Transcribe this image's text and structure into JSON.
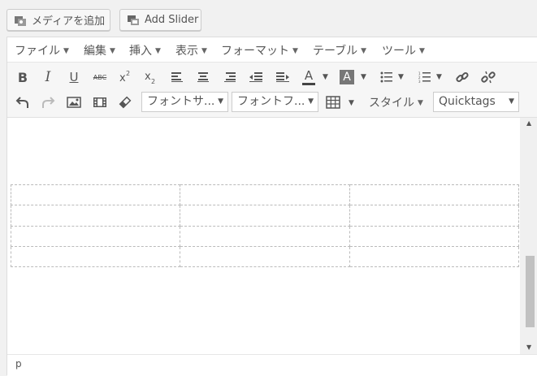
{
  "buttons": {
    "media": "メディアを追加",
    "slider": "Add Slider"
  },
  "menubar": {
    "items": [
      "ファイル",
      "編集",
      "挿入",
      "表示",
      "フォーマット",
      "テーブル",
      "ツール"
    ]
  },
  "toolbar": {
    "row1_icons": [
      "bold-icon",
      "italic-icon",
      "underline-icon",
      "strikethrough-icon",
      "superscript-icon",
      "subscript-icon",
      "align-left-icon",
      "align-center-icon",
      "align-right-icon",
      "outdent-icon",
      "indent-icon",
      "text-color-icon",
      "background-color-icon",
      "bullet-list-icon",
      "numbered-list-icon",
      "link-icon",
      "unlink-icon"
    ],
    "row2_icons": [
      "undo-icon",
      "redo-icon",
      "image-icon",
      "media-icon",
      "eraser-icon",
      "table-icon"
    ],
    "font_size": "フォントサ...",
    "font_family": "フォントフ...",
    "style_label": "スタイル",
    "quicktags": "Quicktags",
    "text_color_letter": "A",
    "bg_color_letter": "A",
    "bold": "B",
    "italic": "I",
    "underline": "U",
    "strike": "ABC"
  },
  "statusbar": {
    "path": "p"
  },
  "colors": {
    "accent_bg": "#f6f6f6",
    "border": "#ddd"
  }
}
